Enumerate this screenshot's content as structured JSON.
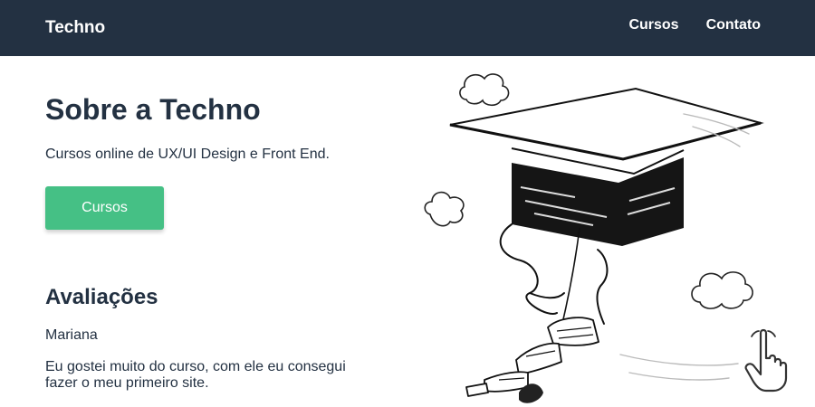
{
  "header": {
    "brand": "Techno",
    "nav": [
      {
        "label": "Cursos"
      },
      {
        "label": "Contato"
      }
    ]
  },
  "hero": {
    "title": "Sobre a Techno",
    "subtitle": "Cursos online de UX/UI Design e Front End.",
    "cta_label": "Cursos"
  },
  "reviews": {
    "title": "Avaliações",
    "items": [
      {
        "name": "Mariana",
        "text": "Eu gostei muito do curso, com ele eu consegui fazer o meu primeiro site."
      }
    ]
  },
  "colors": {
    "header_bg": "#233142",
    "accent": "#45c085",
    "text": "#233142"
  },
  "icons": {
    "illustration": "graduation-cap-illustration",
    "pointer": "hand-pointer-icon"
  }
}
